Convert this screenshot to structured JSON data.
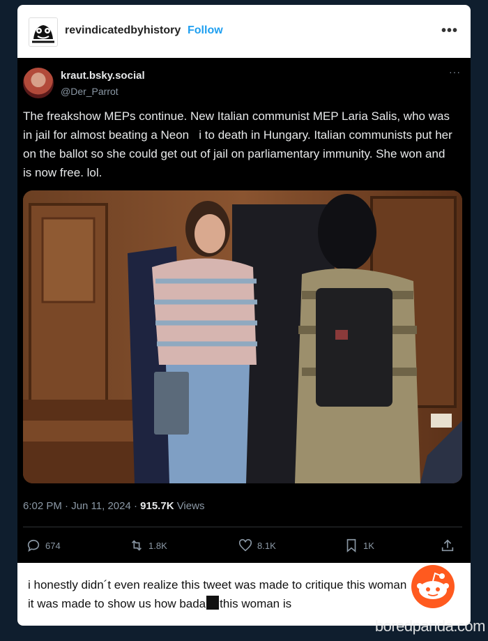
{
  "tumblr_post": {
    "username": "revindicatedbyhistory",
    "follow_label": "Follow",
    "more_label": "•••"
  },
  "tweet": {
    "display_name": "kraut.bsky.social",
    "handle": "@Der_Parrot",
    "more_label": "···",
    "text": "The freakshow MEPs continue. New Italian communist MEP Laria Salis, who was in jail for almost beating a Neon   i to death in Hungary. Italian communists put her on the ballot so she could get out of jail on parliamentary immunity. She won and is now free. lol.",
    "time_date": "6:02 PM · Jun 11, 2024 · ",
    "views_count": "915.7K",
    "views_label": " Views",
    "actions": {
      "replies": "674",
      "reposts": "1.8K",
      "likes": "8.1K",
      "bookmarks": "1K"
    }
  },
  "comment": {
    "text_before": "i honestly didn´t even realize this tweet was made to critique this woman i thought it was made to show us how bada",
    "text_after": "this woman is"
  },
  "watermark": "boredpanda.com",
  "colors": {
    "follow_blue": "#1f9ff0",
    "tweet_bg": "#000000",
    "muted_text": "#8b98a5",
    "boredpanda_orange": "#ff5a1f"
  }
}
